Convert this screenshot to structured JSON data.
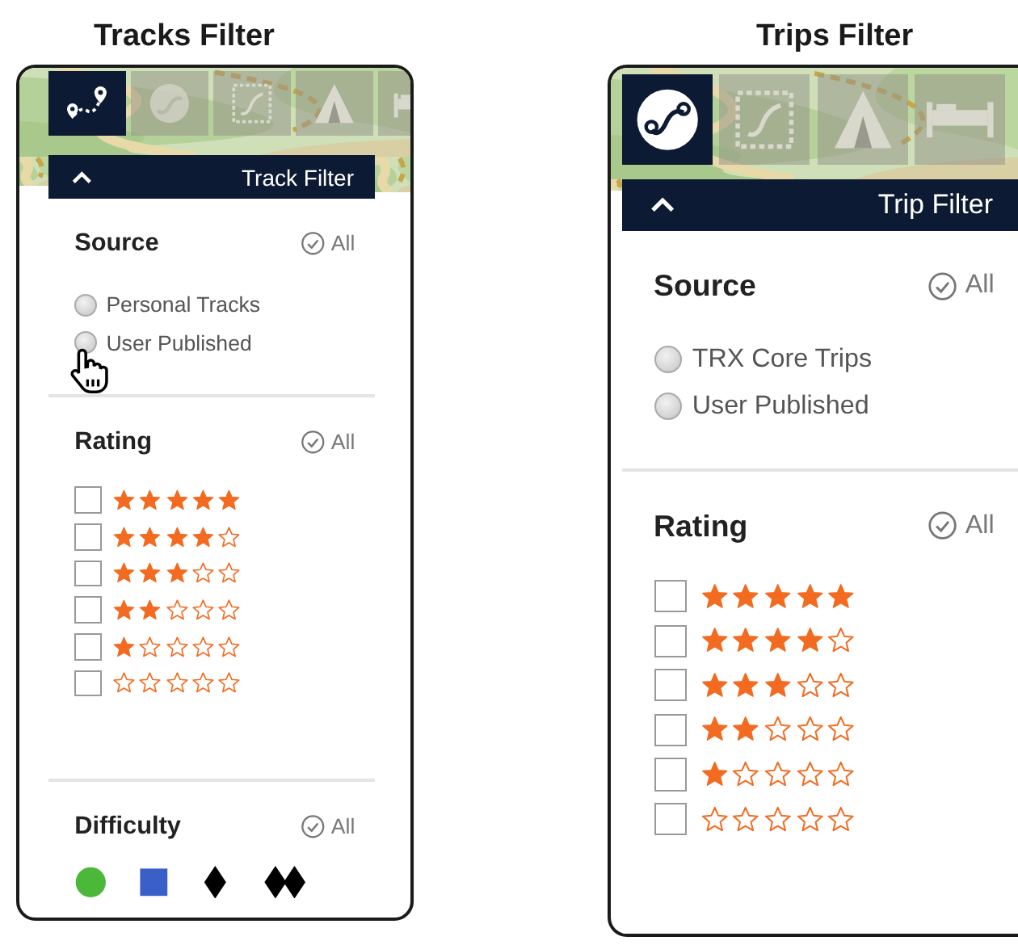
{
  "panels": [
    {
      "title": "Tracks Filter",
      "tabs": [
        {
          "kind": "route",
          "selected": true
        },
        {
          "kind": "round-route",
          "selected": false
        },
        {
          "kind": "map-route",
          "selected": false
        },
        {
          "kind": "tent",
          "selected": false
        },
        {
          "kind": "bed",
          "selected": false
        }
      ],
      "header": {
        "title": "Track Filter"
      },
      "source": {
        "label": "Source",
        "all": "All",
        "options": [
          {
            "label": "Personal Tracks",
            "selected": false,
            "pointer": false
          },
          {
            "label": "User Published",
            "selected": false,
            "pointer": true
          }
        ]
      },
      "rating": {
        "label": "Rating",
        "all": "All",
        "rows": [
          {
            "stars": 5,
            "checked": false
          },
          {
            "stars": 4,
            "checked": false
          },
          {
            "stars": 3,
            "checked": false
          },
          {
            "stars": 2,
            "checked": false
          },
          {
            "stars": 1,
            "checked": false
          },
          {
            "stars": 0,
            "checked": false
          }
        ]
      },
      "difficulty": {
        "label": "Difficulty",
        "all": "All",
        "levels": [
          {
            "kind": "circle",
            "color": "#4cb83a"
          },
          {
            "kind": "square",
            "color": "#3a5fc8"
          },
          {
            "kind": "diamond",
            "color": "#000000"
          },
          {
            "kind": "double-diamond",
            "color": "#000000"
          }
        ]
      }
    },
    {
      "title": "Trips Filter",
      "tabs": [
        {
          "kind": "route-badge",
          "selected": true
        },
        {
          "kind": "map-route",
          "selected": false
        },
        {
          "kind": "tent",
          "selected": false
        },
        {
          "kind": "bed",
          "selected": false
        }
      ],
      "header": {
        "title": "Trip Filter"
      },
      "source": {
        "label": "Source",
        "all": "All",
        "options": [
          {
            "label": "TRX Core Trips",
            "selected": false,
            "pointer": false
          },
          {
            "label": "User Published",
            "selected": false,
            "pointer": false
          }
        ]
      },
      "rating": {
        "label": "Rating",
        "all": "All",
        "rows": [
          {
            "stars": 5,
            "checked": false
          },
          {
            "stars": 4,
            "checked": false
          },
          {
            "stars": 3,
            "checked": false
          },
          {
            "stars": 2,
            "checked": false
          },
          {
            "stars": 1,
            "checked": false
          },
          {
            "stars": 0,
            "checked": false
          }
        ]
      }
    }
  ]
}
